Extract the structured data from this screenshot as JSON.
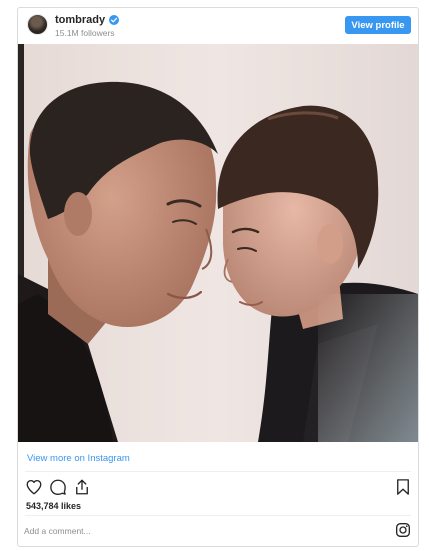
{
  "post": {
    "username": "tombrady",
    "followers": "15.1M followers",
    "view_profile_label": "View profile",
    "view_more_label": "View more on Instagram",
    "likes": "543,784 likes",
    "comment_placeholder": "Add a comment..."
  },
  "icons": {
    "verified": "verified-badge-icon",
    "like": "heart-icon",
    "comment": "comment-icon",
    "share": "share-icon",
    "save": "bookmark-icon",
    "instagram": "instagram-logo-icon"
  },
  "colors": {
    "accent": "#3897f0",
    "border": "#dbdbdb",
    "muted": "#8e8e8e",
    "text": "#262626"
  }
}
